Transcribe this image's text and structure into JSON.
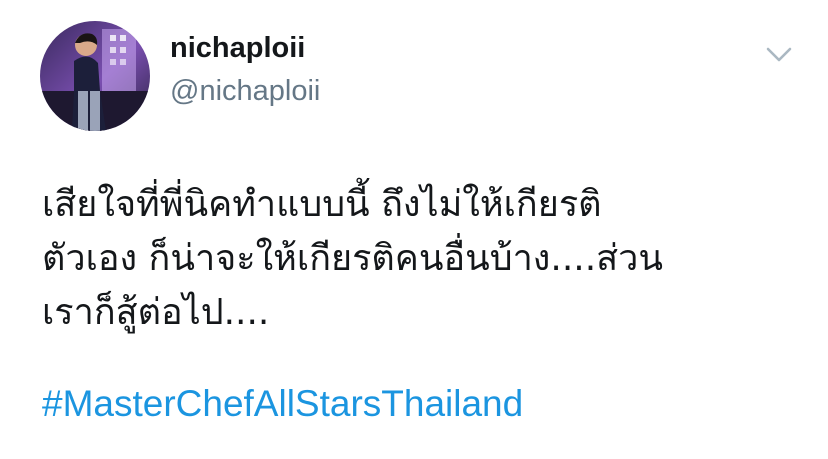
{
  "user": {
    "display_name": "nichaploii",
    "handle": "@nichaploii",
    "avatar_icon": "profile-photo"
  },
  "menu": {
    "icon": "chevron-down-icon"
  },
  "tweet": {
    "lines": [
      "เสียใจที่พี่นิคทำแบบนี้ ถึงไม่ให้เกียรติ",
      "ตัวเอง ก็น่าจะให้เกียรติคนอื่นบ้าง....ส่วน",
      "เราก็สู้ต่อไป...."
    ],
    "hashtag": "#MasterChefAllStarsThailand"
  },
  "colors": {
    "text": "#14171a",
    "secondary": "#657786",
    "link": "#1b95e0",
    "chevron": "#aab8c2"
  }
}
